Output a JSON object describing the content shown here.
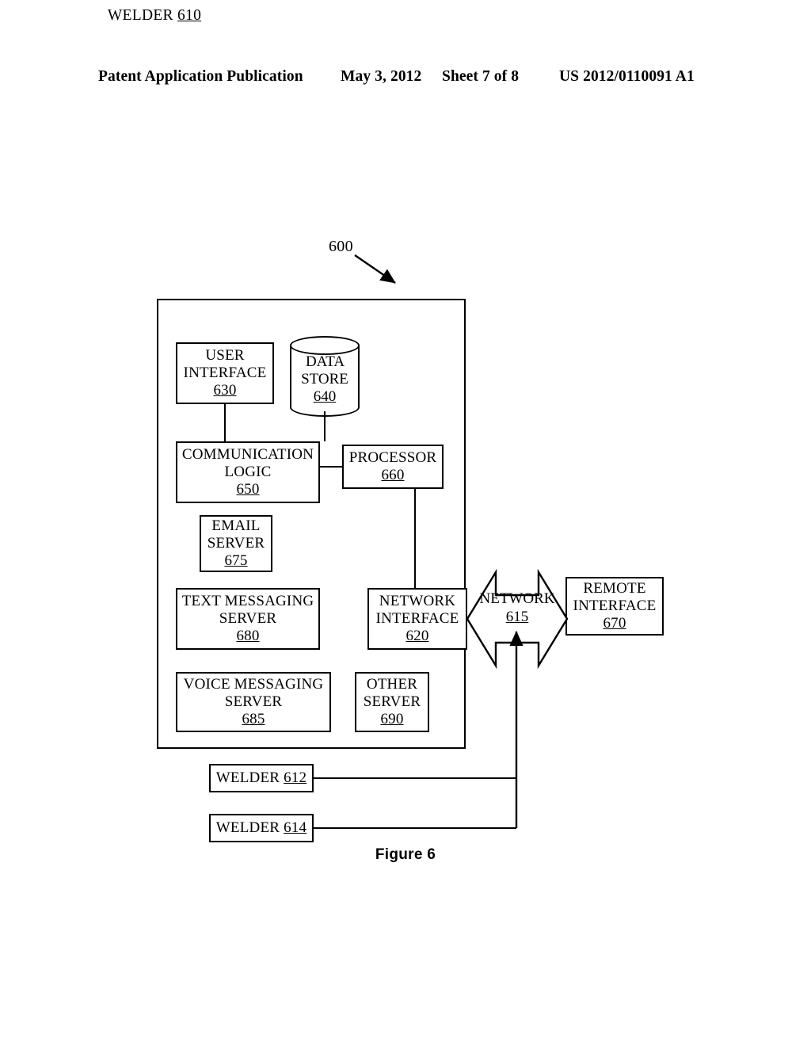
{
  "header": {
    "publication": "Patent Application Publication",
    "date": "May 3, 2012",
    "sheet": "Sheet 7 of 8",
    "patent_number": "US 2012/0110091 A1"
  },
  "figure": {
    "caption": "Figure 6",
    "system_reference": "600"
  },
  "diagram": {
    "outer": {
      "title_text": "WELDER",
      "title_number": "610"
    },
    "nodes": {
      "user_interface": {
        "line1": "USER",
        "line2": "INTERFACE",
        "number": "630"
      },
      "data_store": {
        "line1": "DATA",
        "line2": "STORE",
        "number": "640"
      },
      "comm_logic": {
        "line1": "COMMUNICATION",
        "line2": "LOGIC",
        "number": "650"
      },
      "processor": {
        "line1": "PROCESSOR",
        "number": "660"
      },
      "email_server": {
        "line1": "EMAIL",
        "line2": "SERVER",
        "number": "675"
      },
      "text_server": {
        "line1": "TEXT MESSAGING",
        "line2": "SERVER",
        "number": "680"
      },
      "network_interface": {
        "line1": "NETWORK",
        "line2": "INTERFACE",
        "number": "620"
      },
      "voice_server": {
        "line1": "VOICE MESSAGING",
        "line2": "SERVER",
        "number": "685"
      },
      "other_server": {
        "line1": "OTHER",
        "line2": "SERVER",
        "number": "690"
      },
      "network": {
        "line1": "NETWORK",
        "number": "615"
      },
      "remote_interface": {
        "line1": "REMOTE",
        "line2": "INTERFACE",
        "number": "670"
      },
      "welder_612": {
        "line1": "WELDER",
        "number": "612"
      },
      "welder_614": {
        "line1": "WELDER",
        "number": "614"
      }
    },
    "colors": {
      "stroke": "#000000",
      "background": "#ffffff"
    }
  }
}
